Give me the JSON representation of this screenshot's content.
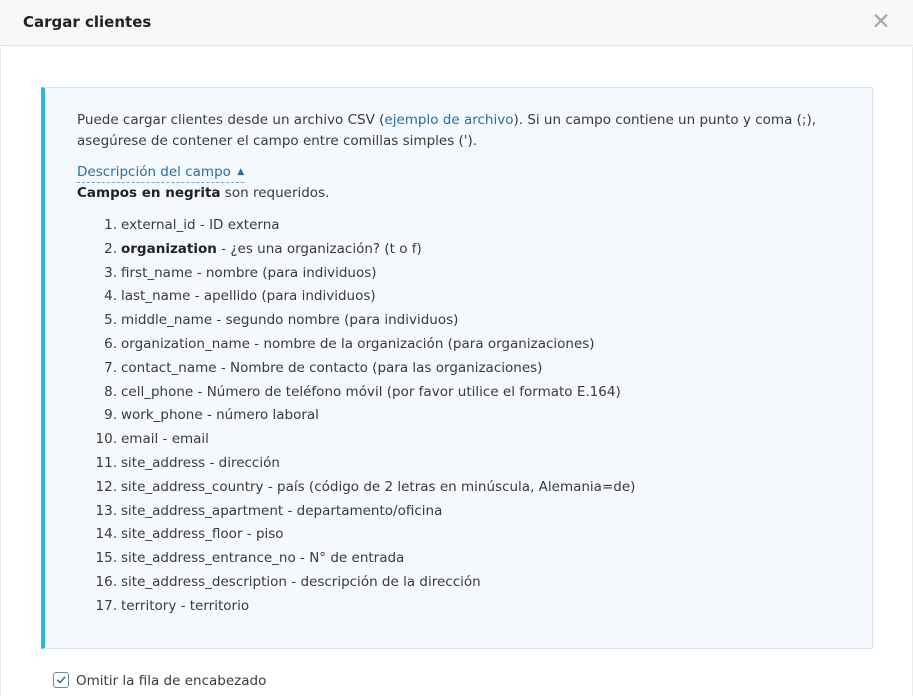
{
  "header": {
    "title": "Cargar clientes",
    "close_glyph": "✕",
    "close_icon": "close-icon"
  },
  "info": {
    "text_before_link": "Puede cargar clientes desde un archivo CSV (",
    "link_label": "ejemplo de archivo",
    "text_after_link": "). Si un campo contiene un punto y coma (;), asegúrese de contener el campo entre comillas simples (').",
    "toggle_label": "Descripción del campo",
    "toggle_icon": "caret-up-icon",
    "required_bold": "Campos en negrita",
    "required_rest": " son requeridos."
  },
  "fields": [
    {
      "num": "1.",
      "name": "external_id",
      "desc": " - ID externa",
      "required": false
    },
    {
      "num": "2.",
      "name": "organization",
      "desc": " - ¿es una organización? (t o f)",
      "required": true
    },
    {
      "num": "3.",
      "name": "first_name",
      "desc": " - nombre (para individuos)",
      "required": false
    },
    {
      "num": "4.",
      "name": "last_name",
      "desc": " - apellido (para individuos)",
      "required": false
    },
    {
      "num": "5.",
      "name": "middle_name",
      "desc": " - segundo nombre (para individuos)",
      "required": false
    },
    {
      "num": "6.",
      "name": "organization_name",
      "desc": " - nombre de la organización (para organizaciones)",
      "required": false
    },
    {
      "num": "7.",
      "name": "contact_name",
      "desc": " - Nombre de contacto (para las organizaciones)",
      "required": false
    },
    {
      "num": "8.",
      "name": "cell_phone",
      "desc": " - Número de teléfono móvil (por favor utilice el formato E.164)",
      "required": false
    },
    {
      "num": "9.",
      "name": "work_phone",
      "desc": " - número laboral",
      "required": false
    },
    {
      "num": "10.",
      "name": "email",
      "desc": " - email",
      "required": false
    },
    {
      "num": "11.",
      "name": "site_address",
      "desc": " - dirección",
      "required": false
    },
    {
      "num": "12.",
      "name": "site_address_country",
      "desc": " - país (código de 2 letras en minúscula, Alemania=de)",
      "required": false
    },
    {
      "num": "13.",
      "name": "site_address_apartment",
      "desc": " - departamento/oficina",
      "required": false
    },
    {
      "num": "14.",
      "name": "site_address_floor",
      "desc": " - piso",
      "required": false
    },
    {
      "num": "15.",
      "name": "site_address_entrance_no",
      "desc": " - N° de entrada",
      "required": false
    },
    {
      "num": "16.",
      "name": "site_address_description",
      "desc": " - descripción de la dirección",
      "required": false
    },
    {
      "num": "17.",
      "name": "territory",
      "desc": " - territorio",
      "required": false
    }
  ],
  "skip_header": {
    "label": "Omitir la fila de encabezado",
    "checked": true
  },
  "colors": {
    "accent_border": "#33b4d6",
    "info_background": "#f3f9fc",
    "link": "#2b6e9e"
  }
}
